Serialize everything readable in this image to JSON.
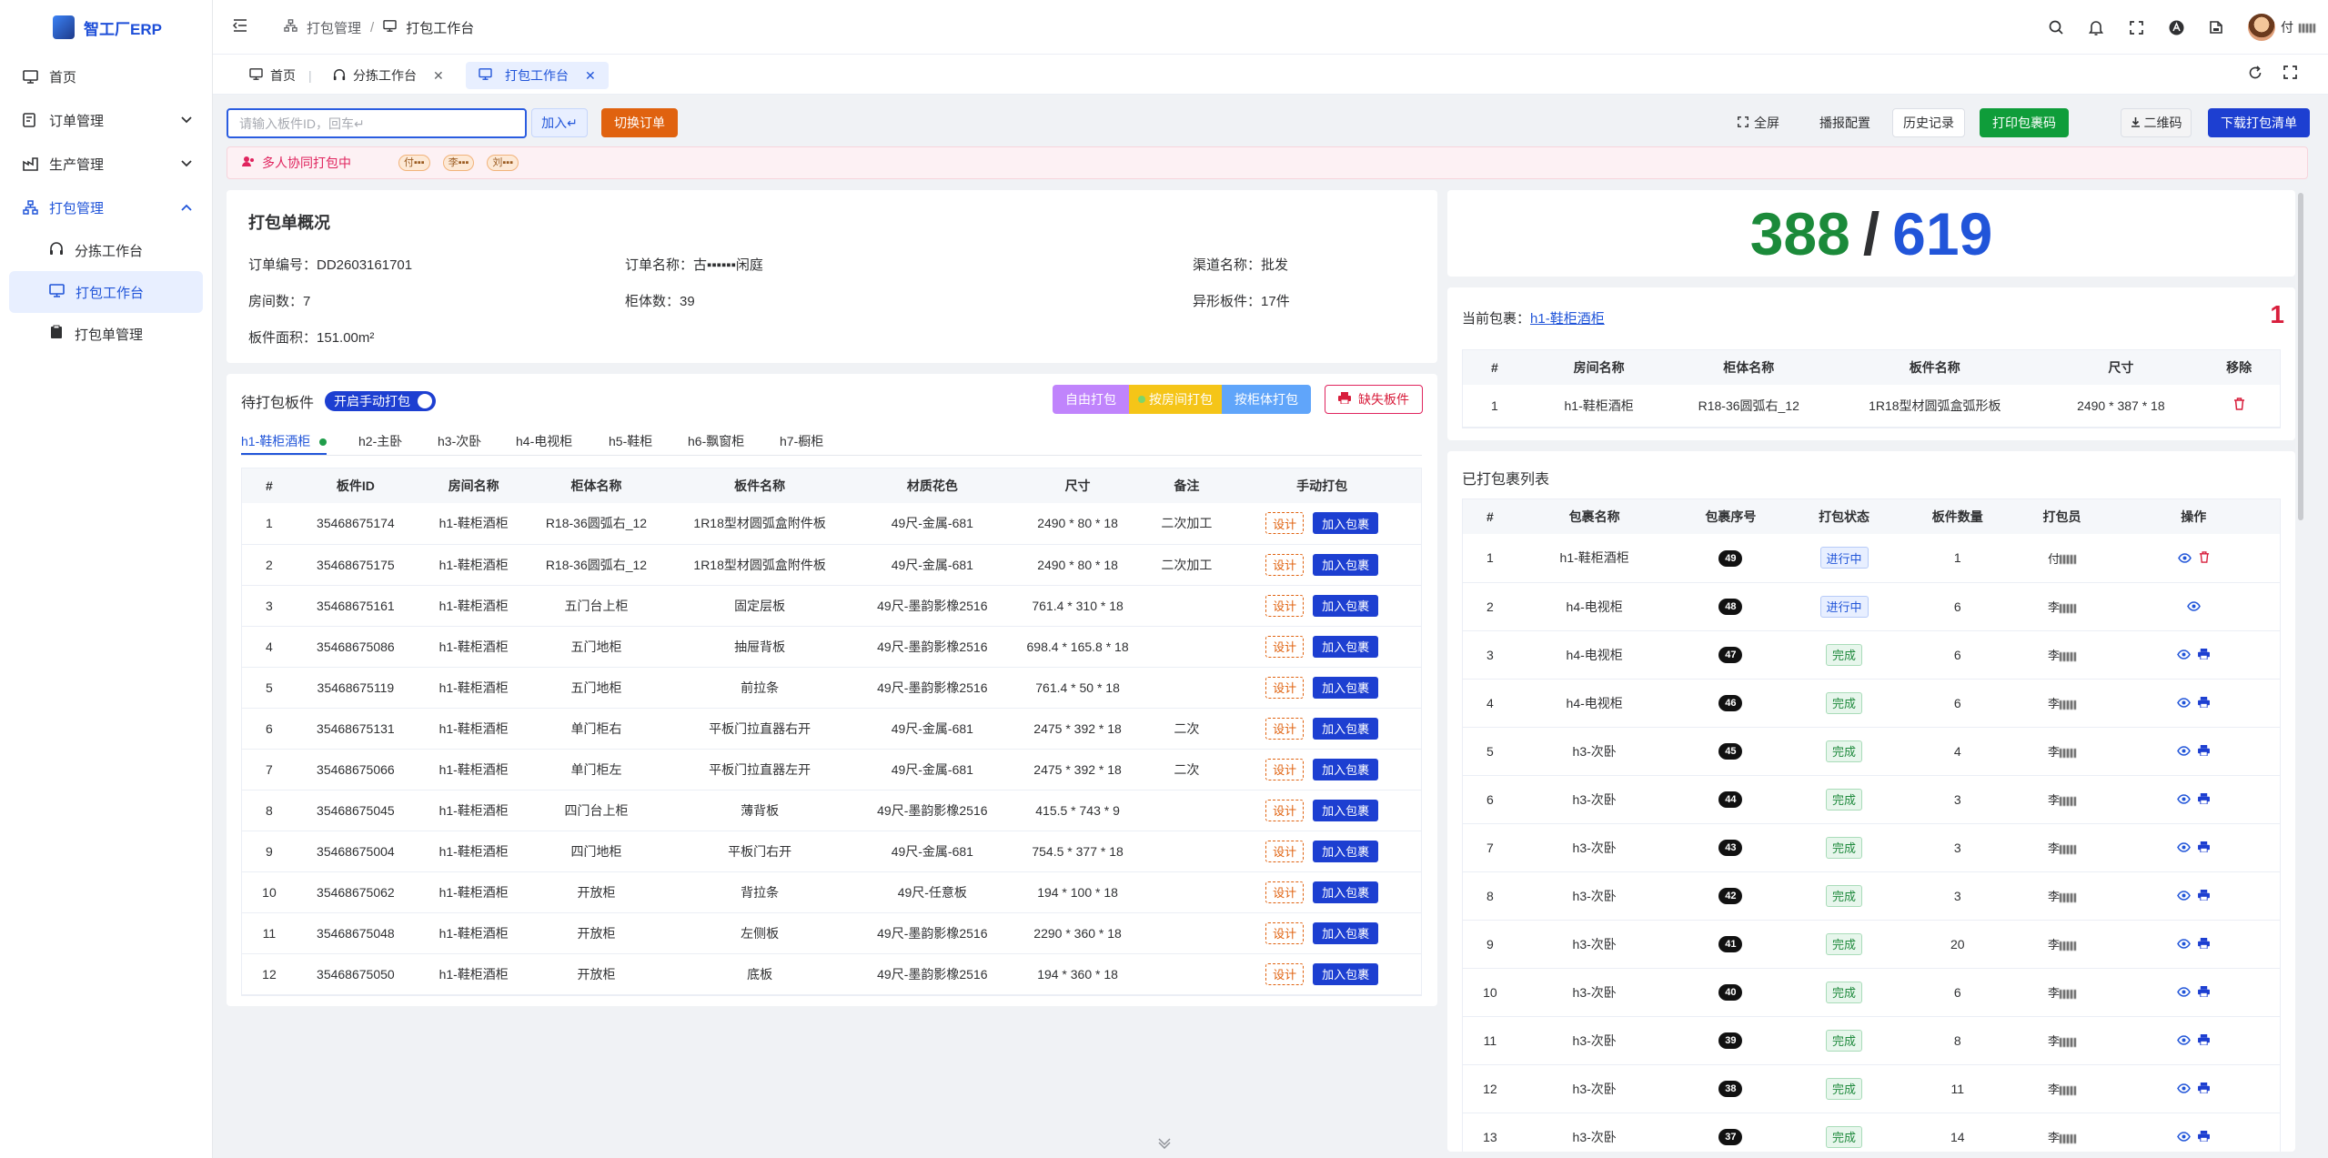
{
  "app": {
    "name": "智工厂ERP"
  },
  "sidebar": {
    "items": [
      {
        "label": "首页"
      },
      {
        "label": "订单管理"
      },
      {
        "label": "生产管理"
      },
      {
        "label": "打包管理"
      }
    ],
    "sub_items": [
      {
        "label": "分拣工作台"
      },
      {
        "label": "打包工作台"
      },
      {
        "label": "打包单管理"
      }
    ]
  },
  "header": {
    "breadcrumb": [
      "打包管理",
      "打包工作台"
    ],
    "user": "付"
  },
  "tabs": [
    {
      "label": "首页"
    },
    {
      "label": "分拣工作台"
    },
    {
      "label": "打包工作台"
    }
  ],
  "toolbar": {
    "search_placeholder": "请输入板件ID，回车↵",
    "add_label": "加入↵",
    "switch_order_label": "切换订单",
    "fullscreen_label": "全屏",
    "broadcast_label": "播报配置",
    "history_label": "历史记录",
    "print_code_label": "打印包裹码",
    "qr_label": "二维码",
    "download_label": "下载打包清单"
  },
  "collab": {
    "text": "多人协同打包中",
    "users": [
      "付",
      "李",
      "刘"
    ]
  },
  "overview": {
    "title": "打包单概况",
    "order_no_label": "订单编号：",
    "order_no": "DD2603161701",
    "order_name_label": "订单名称：",
    "order_name": "古▪▪▪▪▪▪闲庭",
    "channel_label": "渠道名称：",
    "channel": "批发",
    "rooms_label": "房间数：",
    "rooms": "7",
    "cabinets_label": "柜体数：",
    "cabinets": "39",
    "special_label": "异形板件：",
    "special": "17件",
    "area_label": "板件面积：",
    "area": "151.00m²"
  },
  "pending": {
    "title": "待打包板件",
    "manual_toggle": "开启手动打包",
    "free_pack": "自由打包",
    "by_room": "按房间打包",
    "by_cabinet": "按柜体打包",
    "missing": "缺失板件",
    "room_tabs": [
      "h1-鞋柜酒柜",
      "h2-主卧",
      "h3-次卧",
      "h4-电视柜",
      "h5-鞋柜",
      "h6-飘窗柜",
      "h7-橱柜"
    ],
    "columns": [
      "#",
      "板件ID",
      "房间名称",
      "柜体名称",
      "板件名称",
      "材质花色",
      "尺寸",
      "备注",
      "手动打包"
    ],
    "design_label": "设计",
    "add_label": "加入包裹",
    "rows": [
      [
        "1",
        "35468675174",
        "h1-鞋柜酒柜",
        "R18-36圆弧右_12",
        "1R18型材圆弧盒附件板",
        "49尺-金属-681",
        "2490 * 80 * 18",
        "二次加工"
      ],
      [
        "2",
        "35468675175",
        "h1-鞋柜酒柜",
        "R18-36圆弧右_12",
        "1R18型材圆弧盒附件板",
        "49尺-金属-681",
        "2490 * 80 * 18",
        "二次加工"
      ],
      [
        "3",
        "35468675161",
        "h1-鞋柜酒柜",
        "五门台上柜",
        "固定层板",
        "49尺-墨韵影橡2516",
        "761.4 * 310 * 18",
        ""
      ],
      [
        "4",
        "35468675086",
        "h1-鞋柜酒柜",
        "五门地柜",
        "抽屉背板",
        "49尺-墨韵影橡2516",
        "698.4 * 165.8 * 18",
        ""
      ],
      [
        "5",
        "35468675119",
        "h1-鞋柜酒柜",
        "五门地柜",
        "前拉条",
        "49尺-墨韵影橡2516",
        "761.4 * 50 * 18",
        ""
      ],
      [
        "6",
        "35468675131",
        "h1-鞋柜酒柜",
        "单门柜右",
        "平板门拉直器右开",
        "49尺-金属-681",
        "2475 * 392 * 18",
        "二次"
      ],
      [
        "7",
        "35468675066",
        "h1-鞋柜酒柜",
        "单门柜左",
        "平板门拉直器左开",
        "49尺-金属-681",
        "2475 * 392 * 18",
        "二次"
      ],
      [
        "8",
        "35468675045",
        "h1-鞋柜酒柜",
        "四门台上柜",
        "薄背板",
        "49尺-墨韵影橡2516",
        "415.5 * 743 * 9",
        ""
      ],
      [
        "9",
        "35468675004",
        "h1-鞋柜酒柜",
        "四门地柜",
        "平板门右开",
        "49尺-金属-681",
        "754.5 * 377 * 18",
        ""
      ],
      [
        "10",
        "35468675062",
        "h1-鞋柜酒柜",
        "开放柜",
        "背拉条",
        "49尺-任意板",
        "194 * 100 * 18",
        ""
      ],
      [
        "11",
        "35468675048",
        "h1-鞋柜酒柜",
        "开放柜",
        "左侧板",
        "49尺-墨韵影橡2516",
        "2290 * 360 * 18",
        ""
      ],
      [
        "12",
        "35468675050",
        "h1-鞋柜酒柜",
        "开放柜",
        "底板",
        "49尺-墨韵影橡2516",
        "194 * 360 * 18",
        ""
      ]
    ]
  },
  "progress": {
    "done": "388",
    "sep": "/",
    "total": "619",
    "done_value": 388,
    "total_value": 619
  },
  "current": {
    "label": "当前包裹：",
    "name": "h1-鞋柜酒柜",
    "count": "1",
    "columns": [
      "#",
      "房间名称",
      "柜体名称",
      "板件名称",
      "尺寸",
      "移除"
    ],
    "rows": [
      [
        "1",
        "h1-鞋柜酒柜",
        "R18-36圆弧右_12",
        "1R18型材圆弧盒弧形板",
        "2490 * 387 * 18"
      ]
    ]
  },
  "packed": {
    "title": "已打包裹列表",
    "columns": [
      "#",
      "包裹名称",
      "包裹序号",
      "打包状态",
      "板件数量",
      "打包员",
      "操作"
    ],
    "rows": [
      [
        "1",
        "h1-鞋柜酒柜",
        "49",
        "进行中",
        "1",
        "付"
      ],
      [
        "2",
        "h4-电视柜",
        "48",
        "进行中",
        "6",
        "李"
      ],
      [
        "3",
        "h4-电视柜",
        "47",
        "完成",
        "6",
        "李"
      ],
      [
        "4",
        "h4-电视柜",
        "46",
        "完成",
        "6",
        "李"
      ],
      [
        "5",
        "h3-次卧",
        "45",
        "完成",
        "4",
        "李"
      ],
      [
        "6",
        "h3-次卧",
        "44",
        "完成",
        "3",
        "李"
      ],
      [
        "7",
        "h3-次卧",
        "43",
        "完成",
        "3",
        "李"
      ],
      [
        "8",
        "h3-次卧",
        "42",
        "完成",
        "3",
        "李"
      ],
      [
        "9",
        "h3-次卧",
        "41",
        "完成",
        "20",
        "李"
      ],
      [
        "10",
        "h3-次卧",
        "40",
        "完成",
        "6",
        "李"
      ],
      [
        "11",
        "h3-次卧",
        "39",
        "完成",
        "8",
        "李"
      ],
      [
        "12",
        "h3-次卧",
        "38",
        "完成",
        "11",
        "李"
      ],
      [
        "13",
        "h3-次卧",
        "37",
        "完成",
        "14",
        "李"
      ]
    ]
  },
  "colors": {
    "primary": "#1d3fd1",
    "done_green": "#1b8a3a",
    "total_blue": "#2155d9",
    "count_red": "#d81e3c",
    "accent_orange": "#e0620f"
  }
}
